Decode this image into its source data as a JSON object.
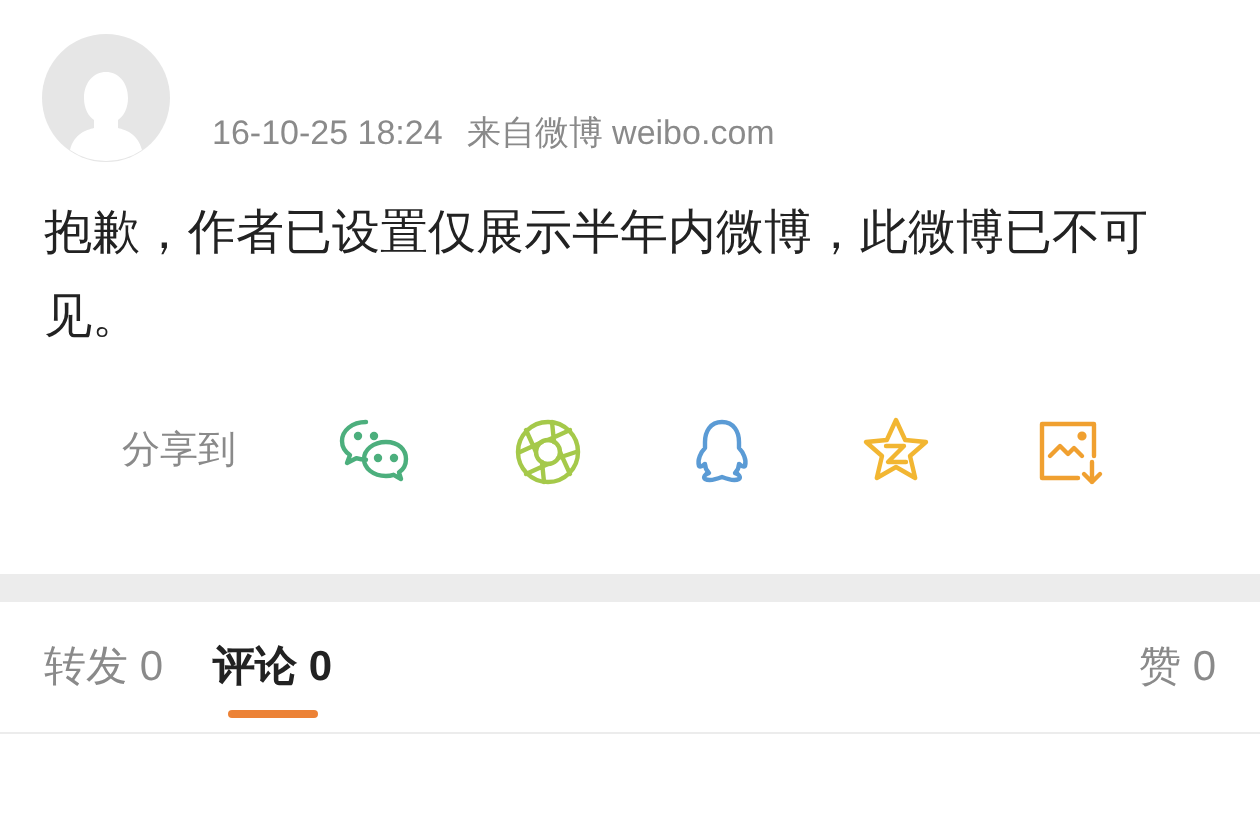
{
  "post": {
    "time": "16-10-25 18:24",
    "source": "来自微博 weibo.com",
    "text": "抱歉，作者已设置仅展示半年内微博，此微博已不可见。"
  },
  "share": {
    "label": "分享到",
    "targets": [
      {
        "kind": "wechat"
      },
      {
        "kind": "moments"
      },
      {
        "kind": "qq"
      },
      {
        "kind": "qzone"
      },
      {
        "kind": "save"
      }
    ]
  },
  "tabs": [
    {
      "label": "转发 0",
      "selected": false
    },
    {
      "label": "评论 0",
      "selected": true
    },
    {
      "label": "赞 0",
      "selected": false
    }
  ]
}
